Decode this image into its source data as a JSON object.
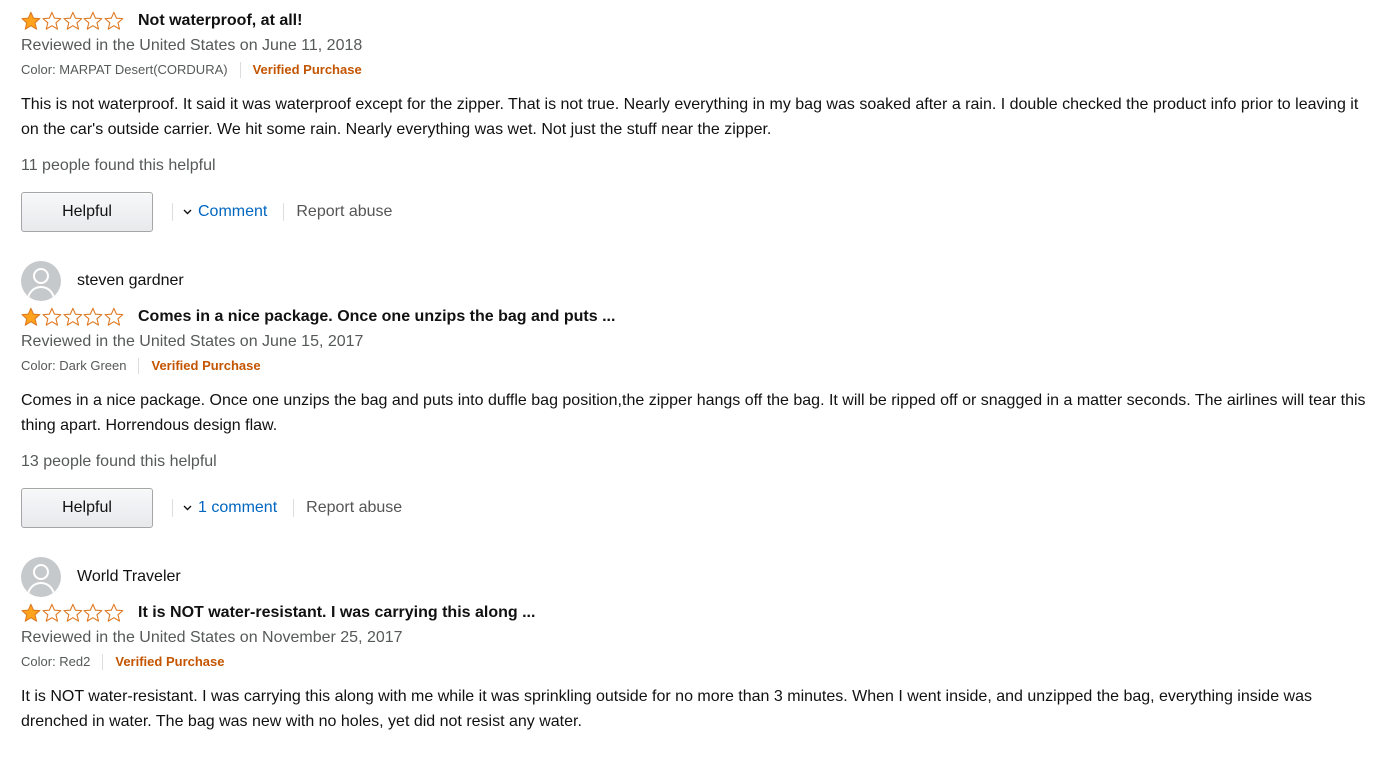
{
  "colors": {
    "star_fill": "#ffa41c",
    "star_outline": "#de7921",
    "verified": "#c45500",
    "link": "#0066c0",
    "muted": "#565959"
  },
  "reviews": [
    {
      "profile_name": "",
      "rating": 1,
      "max_rating": 5,
      "title": "Not waterproof, at all!",
      "date": "Reviewed in the United States on June 11, 2018",
      "color": "Color: MARPAT Desert(CORDURA)",
      "verified": "Verified Purchase",
      "body": "This is not waterproof. It said it was waterproof except for the zipper. That is not true. Nearly everything in my bag was soaked after a rain. I double checked the product info prior to leaving it on the car's outside carrier. We hit some rain. Nearly everything was wet. Not just the stuff near the zipper.",
      "helpful_count": "11 people found this helpful",
      "helpful_label": "Helpful",
      "comment_label": "Comment",
      "report_label": "Report abuse"
    },
    {
      "profile_name": "steven gardner",
      "rating": 1,
      "max_rating": 5,
      "title": "Comes in a nice package. Once one unzips the bag and puts ...",
      "date": "Reviewed in the United States on June 15, 2017",
      "color": "Color: Dark Green",
      "verified": "Verified Purchase",
      "body": "Comes in a nice package. Once one unzips the bag and puts into duffle bag position,the zipper hangs off the bag. It will be ripped off or snagged in a matter seconds. The airlines will tear this thing apart. Horrendous design flaw.",
      "helpful_count": "13 people found this helpful",
      "helpful_label": "Helpful",
      "comment_label": "1 comment",
      "report_label": "Report abuse"
    },
    {
      "profile_name": "World Traveler",
      "rating": 1,
      "max_rating": 5,
      "title": "It is NOT water-resistant. I was carrying this along ...",
      "date": "Reviewed in the United States on November 25, 2017",
      "color": "Color: Red2",
      "verified": "Verified Purchase",
      "body": "It is NOT water-resistant. I was carrying this along with me while it was sprinkling outside for no more than 3 minutes. When I went inside, and unzipped the bag, everything inside was drenched in water. The bag was new with no holes, yet did not resist any water."
    }
  ]
}
